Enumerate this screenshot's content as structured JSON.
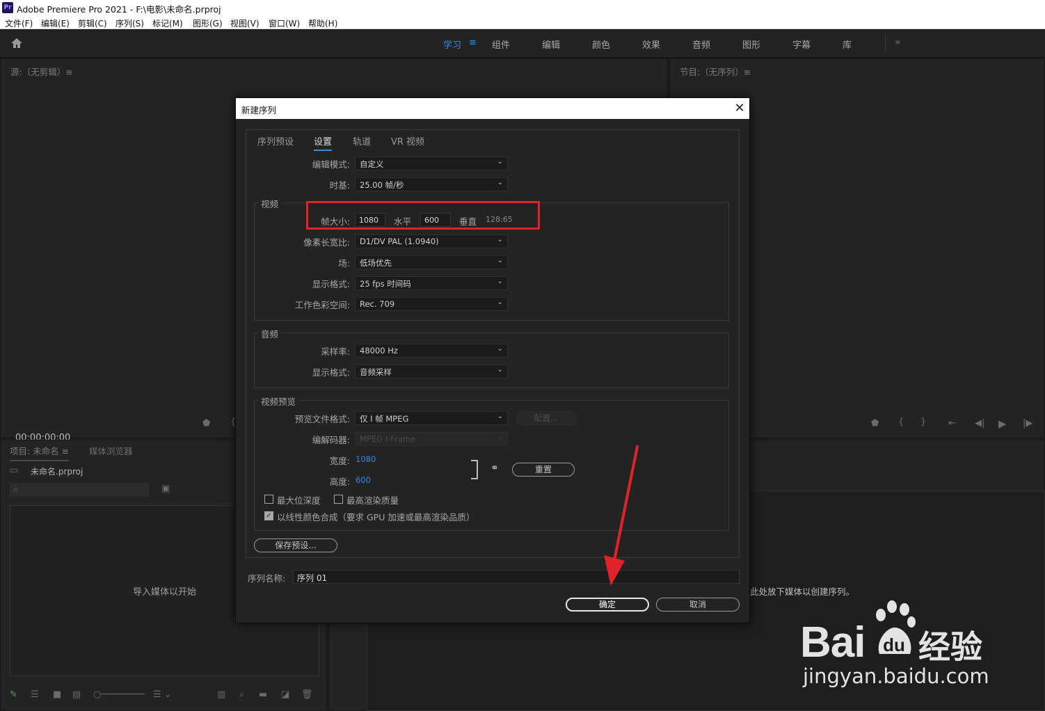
{
  "window": {
    "app_icon": "Pr",
    "title": "Adobe Premiere Pro 2021 - F:\\电影\\未命名.prproj"
  },
  "menu": [
    "文件(F)",
    "编辑(E)",
    "剪辑(C)",
    "序列(S)",
    "标记(M)",
    "图形(G)",
    "视图(V)",
    "窗口(W)",
    "帮助(H)"
  ],
  "workspace": {
    "tabs": [
      "学习",
      "组件",
      "编辑",
      "颜色",
      "效果",
      "音频",
      "图形",
      "字幕",
      "库"
    ],
    "active_tab": "学习",
    "more": "»"
  },
  "source_panel": {
    "title": "源:（无剪辑）≡",
    "timecode": "00:00:00:00"
  },
  "program_panel": {
    "title": "节目:（无序列）≡",
    "drop_hint": "此处放下媒体以创建序列。"
  },
  "project_panel": {
    "tab": "项目: 未命名 ≡",
    "media_browser_tab": "媒体浏览器",
    "file": "未命名.prproj",
    "empty_hint": "导入媒体以开始"
  },
  "dialog": {
    "title": "新建序列",
    "close": "✕",
    "tabs": [
      "序列预设",
      "设置",
      "轨道",
      "VR 视频"
    ],
    "active_tab": "设置",
    "edit_mode": {
      "label": "编辑模式:",
      "value": "自定义"
    },
    "timebase": {
      "label": "时基:",
      "value": "25.00  帧/秒"
    },
    "video": {
      "group": "视频",
      "frame_size_label": "帧大小:",
      "width": "1080",
      "horizontal_label": "水平",
      "height": "600",
      "vertical_label": "垂直",
      "ratio": "128:65",
      "pixel_aspect": {
        "label": "像素长宽比:",
        "value": "D1/DV PAL (1.0940)"
      },
      "fields": {
        "label": "场:",
        "value": "低场优先"
      },
      "display_format": {
        "label": "显示格式:",
        "value": "25 fps 时间码"
      },
      "color_space": {
        "label": "工作色彩空间:",
        "value": "Rec. 709"
      }
    },
    "audio": {
      "group": "音频",
      "sample_rate": {
        "label": "采样率:",
        "value": "48000 Hz"
      },
      "display_format": {
        "label": "显示格式:",
        "value": "音频采样"
      }
    },
    "video_preview": {
      "group": "视频预览",
      "file_format": {
        "label": "预览文件格式:",
        "value": "仅 I 帧 MPEG"
      },
      "configure": "配置...",
      "codec": {
        "label": "编解码器:",
        "value": "MPEG I-Frame"
      },
      "width": {
        "label": "宽度:",
        "value": "1080"
      },
      "height": {
        "label": "高度:",
        "value": "600"
      },
      "reset": "重置",
      "max_bit_depth": {
        "label": "最大位深度",
        "checked": false
      },
      "max_render_quality": {
        "label": "最高渲染质量",
        "checked": false
      },
      "linear_color": {
        "label": "以线性颜色合成（要求 GPU 加速或最高渲染品质）",
        "checked": true
      }
    },
    "save_preset": "保存预设...",
    "sequence_name": {
      "label": "序列名称:",
      "value": "序列 01"
    },
    "ok": "确定",
    "cancel": "取消"
  },
  "watermark": {
    "logo": "Bai",
    "logo_suffix": "经验",
    "url": "jingyan.baidu.com"
  },
  "colors": {
    "accent": "#2d8ceb",
    "highlight": "#e0232b",
    "panel": "#232323"
  }
}
